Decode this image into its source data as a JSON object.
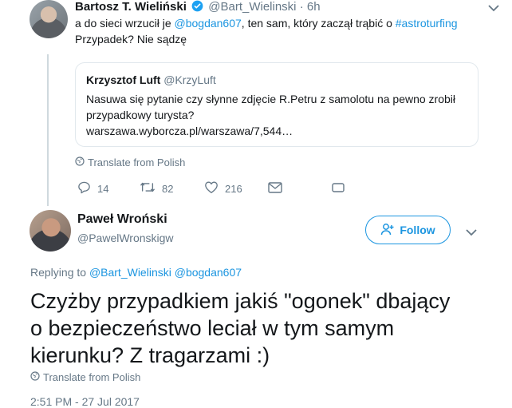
{
  "reply_tweet": {
    "author_name": "Bartosz T. Wieliński",
    "author_handle": "@Bart_Wielinski",
    "separator": "·",
    "time": "6h",
    "text_prefix": "a do sieci wrzucił je ",
    "mention": "@bogdan607",
    "text_middle": ", ten sam, który zaczął trąbić o ",
    "hashtag": "#astroturfing",
    "text_line2": "Przypadek? Nie sądzę",
    "quoted": {
      "author_name": "Krzysztof Luft",
      "author_handle": "@KrzyLuft",
      "text_line1": "Nasuwa się pytanie czy słynne zdjęcie R.Petru z samolotu na pewno zrobił",
      "text_line2": "przypadkowy turysta?",
      "url": "warszawa.wyborcza.pl/warszawa/7,544…"
    },
    "translate_label": "Translate from Polish",
    "actions": {
      "replies": "14",
      "retweets": "82",
      "likes": "216"
    }
  },
  "main_tweet": {
    "author_name": "Paweł Wroński",
    "author_handle": "@PawelWronskigw",
    "follow_label": "Follow",
    "replying_prefix": "Replying to ",
    "replying_mentions": "@Bart_Wielinski @bogdan607",
    "text_line1": "Czyżby przypadkiem jakiś \"ogonek\" dbający",
    "text_line2": "o bezpieczeństwo leciał w tym samym",
    "text_line3": "kierunku? Z tragarzami :)",
    "translate_label": "Translate from Polish",
    "timestamp": "2:51 PM - 27 Jul 2017"
  },
  "colors": {
    "accent": "#1b95e0",
    "muted": "#657786",
    "border": "#e1e8ed"
  }
}
